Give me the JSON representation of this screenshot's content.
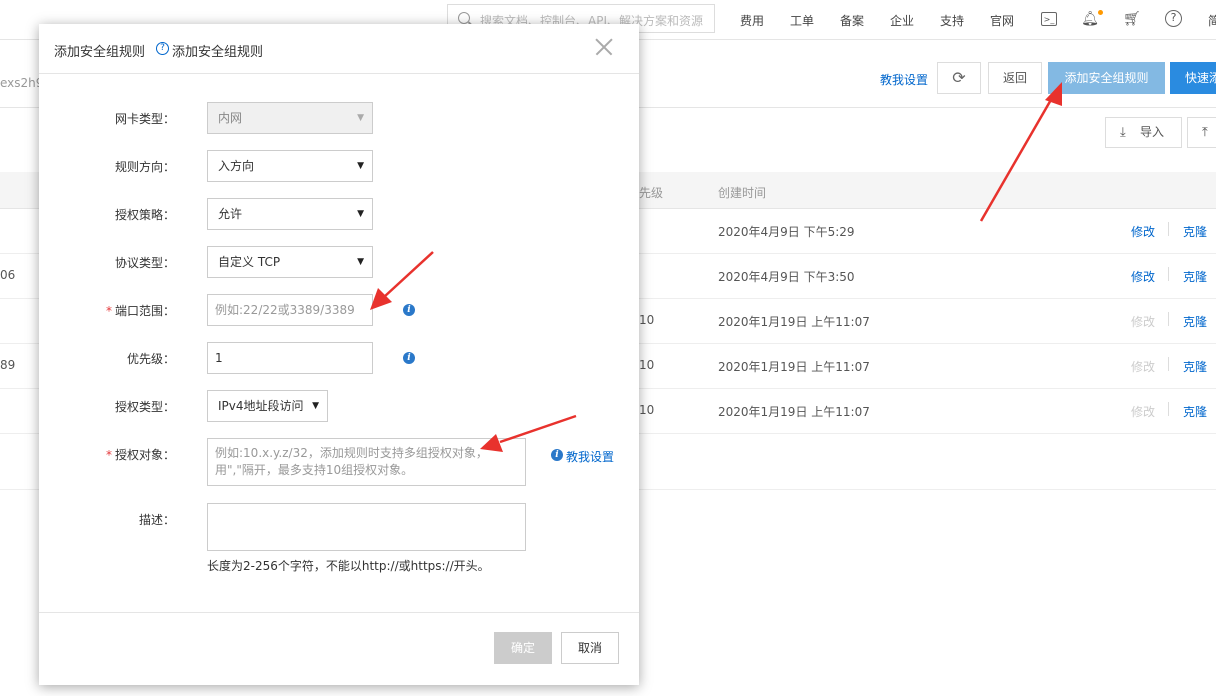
{
  "topbar": {
    "search_placeholder": "搜索文档、控制台、API、解决方案和资源",
    "nav": [
      "费用",
      "工单",
      "备案",
      "企业",
      "支持",
      "官网"
    ],
    "last_cut": "简"
  },
  "subbar": {
    "id_fragment": "exs2h9",
    "teach_link": "教我设置",
    "back_label": "返回",
    "add_rule_label": "添加安全组规则",
    "quick_label": "快速添"
  },
  "toolbar": {
    "import_label": "导入"
  },
  "table": {
    "col_priority": "先级",
    "col_created": "创建时间",
    "rows": [
      {
        "left": "",
        "priority": "",
        "created": "2020年4月9日 下午5:29",
        "edit": "修改",
        "edit_enabled": true,
        "clone": "克隆"
      },
      {
        "left": "06",
        "priority": "",
        "created": "2020年4月9日 下午3:50",
        "edit": "修改",
        "edit_enabled": true,
        "clone": "克隆"
      },
      {
        "left": "",
        "priority": "10",
        "created": "2020年1月19日 上午11:07",
        "edit": "修改",
        "edit_enabled": false,
        "clone": "克隆"
      },
      {
        "left": "89",
        "priority": "10",
        "created": "2020年1月19日 上午11:07",
        "edit": "修改",
        "edit_enabled": false,
        "clone": "克隆"
      },
      {
        "left": "",
        "priority": "10",
        "created": "2020年1月19日 上午11:07",
        "edit": "修改",
        "edit_enabled": false,
        "clone": "克隆"
      }
    ]
  },
  "dialog": {
    "title": "添加安全组规则",
    "subtitle": "添加安全组规则",
    "nic_type_label": "网卡类型：",
    "nic_type_value": "内网",
    "direction_label": "规则方向：",
    "direction_value": "入方向",
    "policy_label": "授权策略：",
    "policy_value": "允许",
    "protocol_label": "协议类型：",
    "protocol_value": "自定义 TCP",
    "port_label": "端口范围：",
    "port_placeholder": "例如:22/22或3389/3389",
    "priority_label": "优先级：",
    "priority_value": "1",
    "auth_type_label": "授权类型：",
    "auth_type_value": "IPv4地址段访问",
    "auth_object_label": "授权对象：",
    "auth_object_placeholder": "例如:10.x.y.z/32，添加规则时支持多组授权对象，用\",\"隔开，最多支持10组授权对象。",
    "teach_link": "教我设置",
    "desc_label": "描述：",
    "desc_hint": "长度为2-256个字符，不能以http://或https://开头。",
    "ok_label": "确定",
    "cancel_label": "取消"
  },
  "colors": {
    "primary": "#2a8be0",
    "primary_disabled": "#83b9e3",
    "link": "#0066cc",
    "required": "#e4393c",
    "annotation_arrow": "#e8322d"
  }
}
